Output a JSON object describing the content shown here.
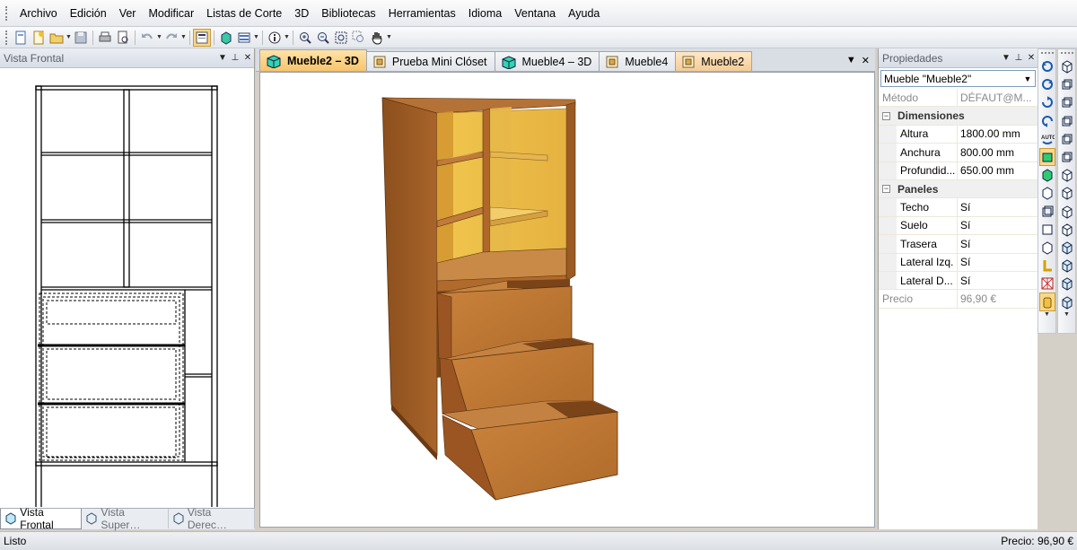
{
  "menu": [
    "Archivo",
    "Edición",
    "Ver",
    "Modificar",
    "Listas de Corte",
    "3D",
    "Bibliotecas",
    "Herramientas",
    "Idioma",
    "Ventana",
    "Ayuda"
  ],
  "toolbar": {
    "icons": [
      "new-icon",
      "new-from-template-icon",
      "open-icon",
      "save-icon",
      "print-icon",
      "print-preview-icon",
      "undo-icon",
      "redo-icon",
      "properties-icon",
      "3d-view-icon",
      "cut-list-icon",
      "info-icon",
      "zoom-in-icon",
      "zoom-out-icon",
      "zoom-extents-icon",
      "zoom-window-icon",
      "pan-hand-icon"
    ]
  },
  "left_pane": {
    "title": "Vista Frontal",
    "tabs": [
      {
        "label": "Vista Frontal",
        "active": true
      },
      {
        "label": "Vista Super…",
        "active": false
      },
      {
        "label": "Vista Derec…",
        "active": false
      }
    ]
  },
  "doc_tabs": [
    {
      "label": "Mueble2 – 3D",
      "active": true,
      "icon": "cube-3d-icon"
    },
    {
      "label": "Prueba Mini Clóset",
      "active": false,
      "icon": "furniture-doc-icon"
    },
    {
      "label": "Mueble4 – 3D",
      "active": false,
      "icon": "cube-3d-icon"
    },
    {
      "label": "Mueble4",
      "active": false,
      "icon": "furniture-doc-icon"
    },
    {
      "label": "Mueble2",
      "active": false,
      "icon": "furniture-doc-icon"
    }
  ],
  "properties": {
    "title": "Propiedades",
    "selected_object": "Mueble \"Mueble2\"",
    "method": {
      "label": "Método",
      "value": "DÉFAUT@M..."
    },
    "dimensions": {
      "category": "Dimensiones",
      "rows": [
        {
          "label": "Altura",
          "value": "1800.00 mm"
        },
        {
          "label": "Anchura",
          "value": "800.00 mm"
        },
        {
          "label": "Profundid...",
          "value": "650.00 mm"
        }
      ]
    },
    "panels": {
      "category": "Paneles",
      "rows": [
        {
          "label": "Techo",
          "value": "Sí"
        },
        {
          "label": "Suelo",
          "value": "Sí"
        },
        {
          "label": "Trasera",
          "value": "Sí"
        },
        {
          "label": "Lateral Izq.",
          "value": "Sí"
        },
        {
          "label": "Lateral D...",
          "value": "Sí"
        }
      ]
    },
    "price": {
      "label": "Precio",
      "value": "96,90 €"
    }
  },
  "status": {
    "left": "Listo",
    "right": "Precio: 96,90 €"
  },
  "colors": {
    "wood": "#b5702e",
    "wood_dark": "#8a4f1c",
    "wood_light": "#e0b24a",
    "accent_tab": "#f7c56b"
  }
}
